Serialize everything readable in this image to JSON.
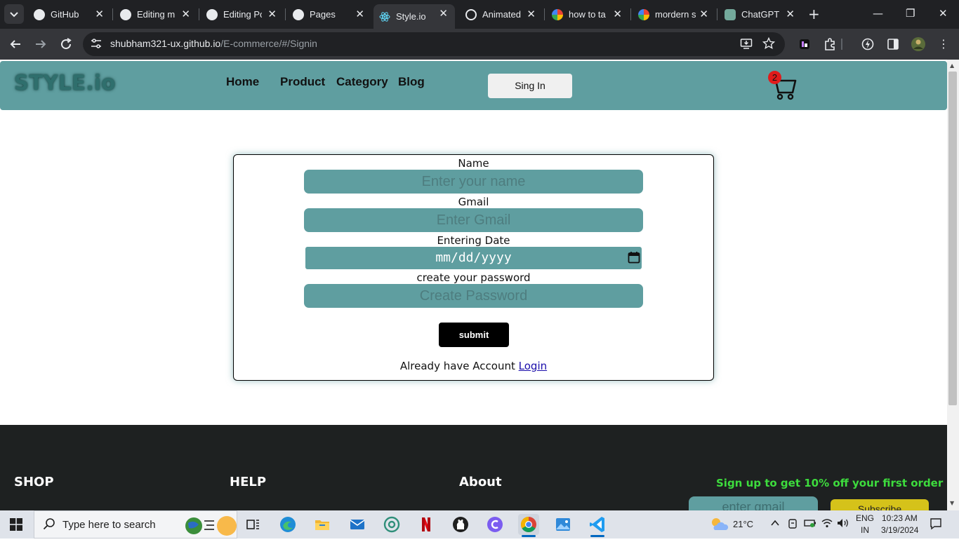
{
  "browser": {
    "tabs": [
      {
        "title": "GitHub",
        "icon": "github-icon"
      },
      {
        "title": "Editing m",
        "icon": "github-icon"
      },
      {
        "title": "Editing Po",
        "icon": "github-icon"
      },
      {
        "title": "Pages",
        "icon": "github-icon"
      },
      {
        "title": "Style.io",
        "icon": "react-icon",
        "active": true
      },
      {
        "title": "Animated",
        "icon": "globe-icon"
      },
      {
        "title": "how to ta",
        "icon": "google-icon"
      },
      {
        "title": "mordern s",
        "icon": "google-icon"
      },
      {
        "title": "ChatGPT",
        "icon": "chatgpt-icon"
      }
    ],
    "url_host": "shubham321-ux.github.io",
    "url_path": "/E-commerce/#/Signin"
  },
  "site": {
    "brand": "STYLE.io",
    "nav": [
      "Home",
      "Product",
      "Category",
      "Blog"
    ],
    "signin_label": "Sing In",
    "cart_count": "2"
  },
  "form": {
    "name_label": "Name",
    "name_placeholder": "Enter your name",
    "gmail_label": "Gmail",
    "gmail_placeholder": "Enter Gmail",
    "date_label": "Entering Date",
    "date_placeholder": "mm/dd/yyyy",
    "password_label": "create your password",
    "password_placeholder": "Create Password",
    "submit_label": "submit",
    "login_prompt": "Already have Account",
    "login_link": "Login"
  },
  "footer": {
    "shop": "SHOP",
    "help": "HELP",
    "about": "About",
    "promo": "Sign up to get 10% off your first order",
    "email_placeholder": "enter gmail",
    "subscribe_label": "Subscribe"
  },
  "taskbar": {
    "search_placeholder": "Type here to search",
    "temperature": "21°C",
    "language_top": "ENG",
    "language_bottom": "IN",
    "time": "10:23 AM",
    "date": "3/19/2024"
  },
  "colors": {
    "accent": "#5f9ea0",
    "footer_bg": "#1e2121",
    "promo": "#3ddc3d",
    "subscribe": "#d5c21a"
  }
}
